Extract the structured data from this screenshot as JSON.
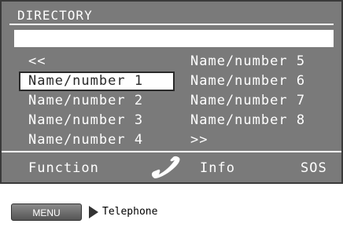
{
  "screen": {
    "title": "DIRECTORY",
    "search_value": "",
    "left_items": [
      "<<",
      "Name/number 1",
      "Name/number 2",
      "Name/number 3",
      "Name/number 4"
    ],
    "right_items": [
      "Name/number 5",
      "Name/number 6",
      "Name/number 7",
      "Name/number 8",
      ">>"
    ],
    "selected": "Name/number 1"
  },
  "softkeys": {
    "function": "Function",
    "phone_icon": "handset-icon",
    "info": "Info",
    "sos": "SOS"
  },
  "footer": {
    "menu_label": "MENU",
    "breadcrumb": "Telephone"
  },
  "colors": {
    "screen_bg": "#7a7a7a",
    "text": "#ffffff",
    "selected_text": "#2a2a2a"
  }
}
